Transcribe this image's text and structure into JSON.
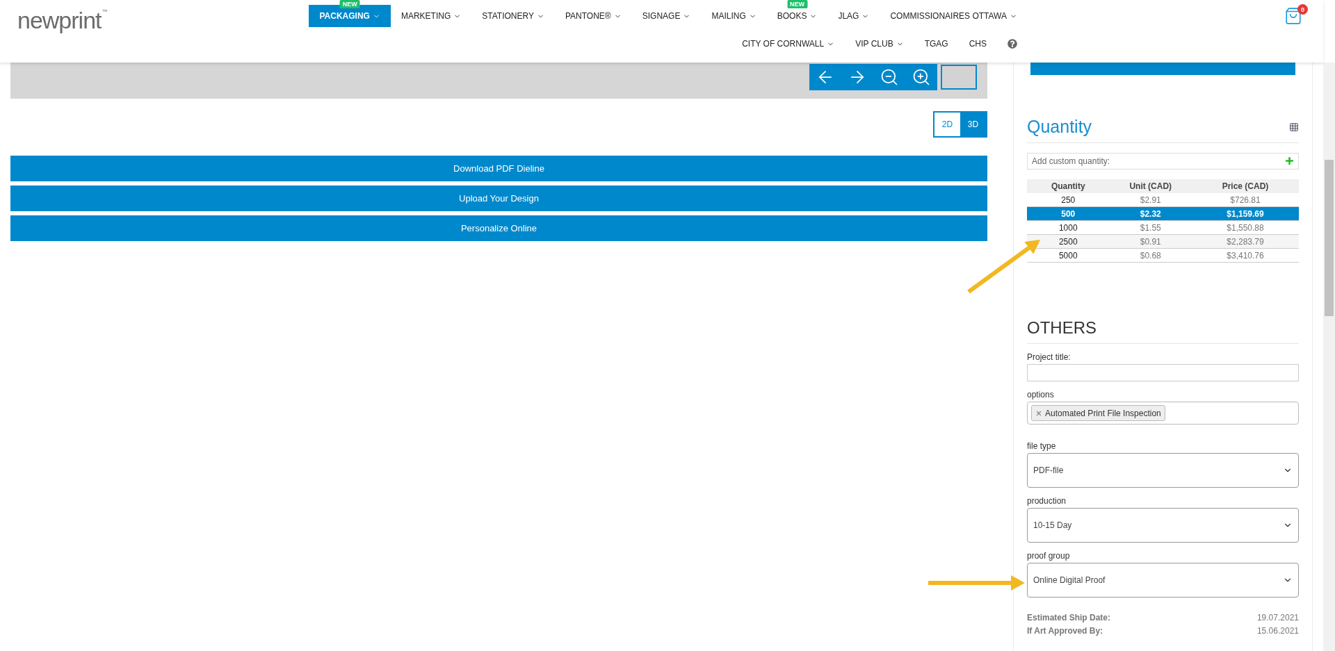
{
  "logo": {
    "text": "newprint",
    "mark": "™"
  },
  "nav_rows": [
    [
      {
        "kind": "menu",
        "label": "PACKAGING",
        "selected": true,
        "badge": "NEW"
      },
      {
        "kind": "menu",
        "label": "MARKETING",
        "selected": false
      },
      {
        "kind": "menu",
        "label": "STATIONERY",
        "selected": false
      },
      {
        "kind": "menu",
        "label": "PANTONE®",
        "selected": false
      },
      {
        "kind": "menu",
        "label": "SIGNAGE",
        "selected": false
      },
      {
        "kind": "menu",
        "label": "MAILING",
        "selected": false
      },
      {
        "kind": "menu",
        "label": "BOOKS",
        "selected": false,
        "badge": "NEW"
      },
      {
        "kind": "menu",
        "label": "JLAG",
        "selected": false
      },
      {
        "kind": "menu",
        "label": "COMMISSIONAIRES OTTAWA",
        "selected": false
      }
    ],
    [
      {
        "kind": "menu",
        "label": "CITY OF CORNWALL",
        "selected": false
      },
      {
        "kind": "menu",
        "label": "VIP CLUB",
        "selected": false
      },
      {
        "kind": "link",
        "label": "TGAG",
        "selected": false
      },
      {
        "kind": "link",
        "label": "CHS",
        "selected": false
      },
      {
        "kind": "help",
        "selected": false
      }
    ]
  ],
  "cart": {
    "count": "0"
  },
  "view_modes": [
    {
      "label": "2D",
      "selected": false
    },
    {
      "label": "3D",
      "selected": true
    }
  ],
  "actions": [
    "Download PDF Dieline",
    "Upload Your Design",
    "Personalize Online"
  ],
  "quantity": {
    "title": "Quantity",
    "custom_placeholder": "Add custom quantity:",
    "columns": [
      "Quantity",
      "Unit (CAD)",
      "Price (CAD)"
    ],
    "rows": [
      {
        "cells": [
          "250",
          "$2.91",
          "$726.81"
        ],
        "selected": false
      },
      {
        "cells": [
          "500",
          "$2.32",
          "$1,159.69"
        ],
        "selected": true
      },
      {
        "cells": [
          "1000",
          "$1.55",
          "$1,550.88"
        ],
        "selected": false
      },
      {
        "cells": [
          "2500",
          "$0.91",
          "$2,283.79"
        ],
        "selected": false
      },
      {
        "cells": [
          "5000",
          "$0.68",
          "$3,410.76"
        ],
        "selected": false
      }
    ]
  },
  "others": {
    "title": "OTHERS",
    "fields": [
      {
        "kind": "text",
        "label": "Project title:"
      },
      {
        "kind": "tags",
        "label": "options",
        "tags": [
          "Automated Print File Inspection"
        ]
      },
      {
        "kind": "select",
        "label": "file type",
        "value": "PDF-file"
      },
      {
        "kind": "select",
        "label": "production",
        "value": "10-15 Day"
      },
      {
        "kind": "select",
        "label": "proof group",
        "value": "Online Digital Proof"
      }
    ]
  },
  "dates": [
    {
      "label": "Estimated Ship Date:",
      "value": "19.07.2021"
    },
    {
      "label": "If Art Approved By:",
      "value": "15.06.2021"
    }
  ]
}
